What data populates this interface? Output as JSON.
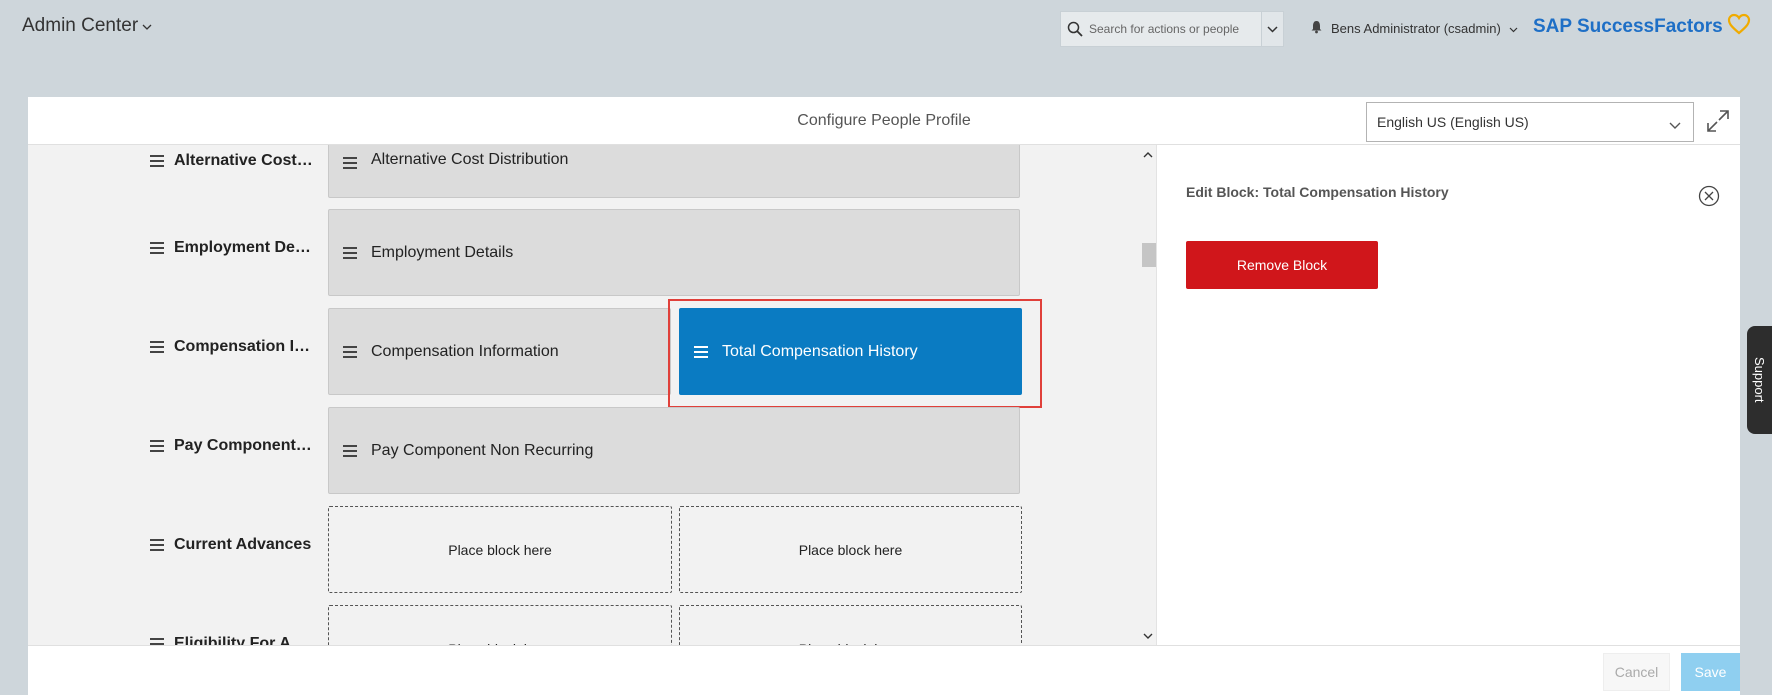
{
  "header": {
    "app_title": "Admin Center",
    "search_placeholder": "Search for actions or people",
    "user_name": "Bens Administrator (csadmin)",
    "brand": "SAP SuccessFactors",
    "brand_color": "#1e6fc6"
  },
  "panel": {
    "title": "Configure People Profile",
    "language": "English US (English US)"
  },
  "rows": [
    {
      "label": "Alternative Cost…",
      "blocks": [
        "Alternative Cost Distribution"
      ]
    },
    {
      "label": "Employment De…",
      "blocks": [
        "Employment Details"
      ]
    },
    {
      "label": "Compensation I…",
      "blocks": [
        "Compensation Information"
      ],
      "selected_block": "Total Compensation History"
    },
    {
      "label": "Pay Component…",
      "blocks": [
        "Pay Component Non Recurring"
      ]
    },
    {
      "label": "Current Advances",
      "placeholders": [
        "Place block here",
        "Place block here"
      ]
    },
    {
      "label": "Eligibility For A…",
      "placeholders": [
        "Place block here",
        "Place block here"
      ]
    }
  ],
  "edit_panel": {
    "title": "Edit Block: Total Compensation History",
    "remove_label": "Remove Block",
    "remove_color": "#d0161b"
  },
  "footer": {
    "cancel_label": "Cancel",
    "save_label": "Save"
  },
  "support_label": "Support",
  "selected_color": "#0a7bc2"
}
